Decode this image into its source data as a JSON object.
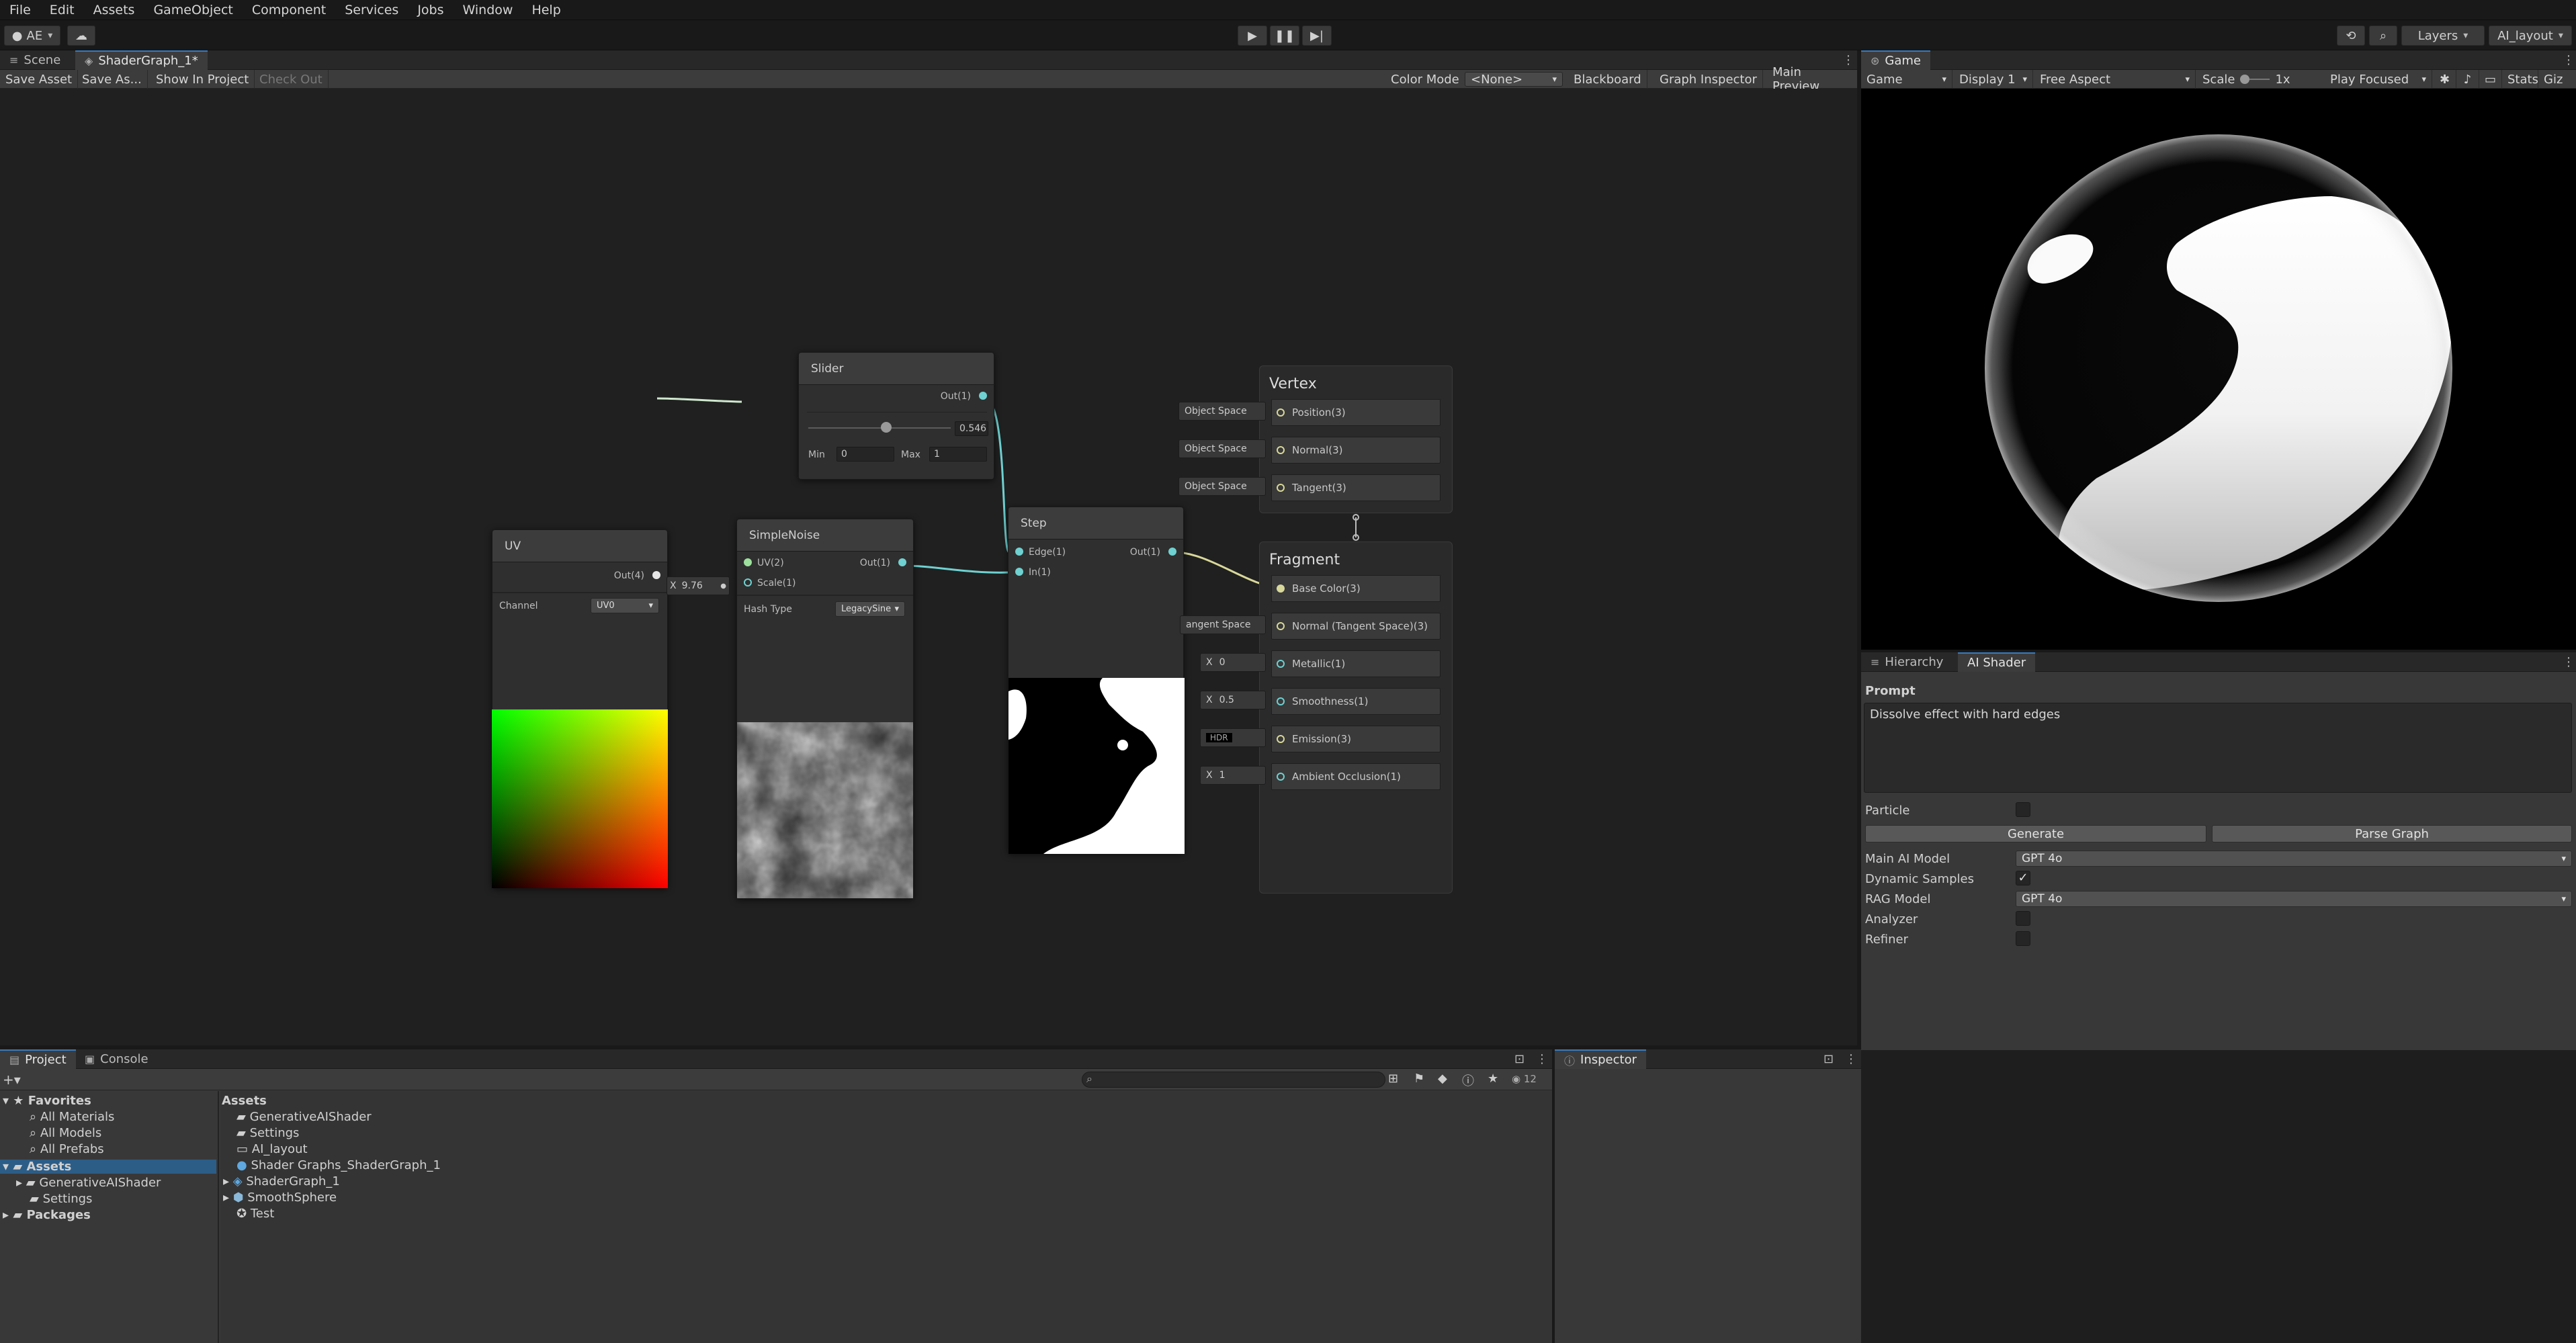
{
  "menu": [
    "File",
    "Edit",
    "Assets",
    "GameObject",
    "Component",
    "Services",
    "Jobs",
    "Window",
    "Help"
  ],
  "toolbar": {
    "account": "AE",
    "layers": "Layers",
    "layout": "AI_layout"
  },
  "scene_tabs": {
    "scene": "Scene",
    "shadergraph": "ShaderGraph_1*"
  },
  "graph_toolbar": {
    "save_asset": "Save Asset",
    "save_as": "Save As...",
    "show_in_project": "Show In Project",
    "check_out": "Check Out",
    "color_mode_label": "Color Mode",
    "color_mode_value": "<None>",
    "blackboard": "Blackboard",
    "graph_inspector": "Graph Inspector",
    "main_preview": "Main Preview"
  },
  "nodes": {
    "slider": {
      "title": "Slider",
      "out": "Out(1)",
      "value": "0.546",
      "value_num": 0.546,
      "min_label": "Min",
      "min": "0",
      "max_label": "Max",
      "max": "1"
    },
    "uv": {
      "title": "UV",
      "out": "Out(4)",
      "channel_label": "Channel",
      "channel": "UV0"
    },
    "noise": {
      "title": "SimpleNoise",
      "uv": "UV(2)",
      "scale": "Scale(1)",
      "out": "Out(1)",
      "hash_label": "Hash Type",
      "hash": "LegacySine",
      "scale_x": "X",
      "scale_value": "9.76"
    },
    "step": {
      "title": "Step",
      "edge": "Edge(1)",
      "in": "In(1)",
      "out": "Out(1)"
    },
    "vertex": {
      "title": "Vertex",
      "slots": [
        {
          "label": "Position(3)",
          "tag": "Object Space"
        },
        {
          "label": "Normal(3)",
          "tag": "Object Space"
        },
        {
          "label": "Tangent(3)",
          "tag": "Object Space"
        }
      ]
    },
    "fragment": {
      "title": "Fragment",
      "slots": [
        {
          "label": "Base Color(3)",
          "tag": ""
        },
        {
          "label": "Normal (Tangent Space)(3)",
          "tag": "angent Space"
        },
        {
          "label": "Metallic(1)",
          "tag": "0"
        },
        {
          "label": "Smoothness(1)",
          "tag": "0.5"
        },
        {
          "label": "Emission(3)",
          "tag": "HDR"
        },
        {
          "label": "Ambient Occlusion(1)",
          "tag": "1"
        }
      ],
      "x_label": "X"
    }
  },
  "game": {
    "tab": "Game",
    "mode": "Game",
    "display": "Display 1",
    "aspect": "Free Aspect",
    "scale_label": "Scale",
    "scale_value": "1x",
    "play_focused": "Play Focused",
    "stats": "Stats",
    "gizmos": "Giz"
  },
  "ai_panel": {
    "tab_hierarchy": "Hierarchy",
    "tab_ai": "AI Shader",
    "prompt_label": "Prompt",
    "prompt_text": "Dissolve effect with hard edges",
    "particle_label": "Particle",
    "generate": "Generate",
    "parse_graph": "Parse Graph",
    "main_model_label": "Main AI Model",
    "main_model": "GPT 4o",
    "dynamic_label": "Dynamic Samples",
    "rag_label": "RAG Model",
    "rag_model": "GPT 4o",
    "analyzer_label": "Analyzer",
    "refiner_label": "Refiner"
  },
  "project": {
    "tab_project": "Project",
    "tab_console": "Console",
    "badge": "12",
    "favorites": "Favorites",
    "fav_items": [
      "All Materials",
      "All Models",
      "All Prefabs"
    ],
    "assets_root": "Assets",
    "tree_children": [
      "GenerativeAIShader",
      "Settings"
    ],
    "packages": "Packages",
    "assets_header": "Assets",
    "assets": [
      "GenerativeAIShader",
      "Settings",
      "AI_layout",
      "Shader Graphs_ShaderGraph_1",
      "ShaderGraph_1",
      "SmoothSphere",
      "Test"
    ]
  },
  "inspector": {
    "tab": "Inspector"
  },
  "colors": {
    "accent": "#3a79bb",
    "wire_cyan": "#6fd1d1",
    "wire_yellow": "#d8d89a",
    "port_green": "#9de09d"
  }
}
